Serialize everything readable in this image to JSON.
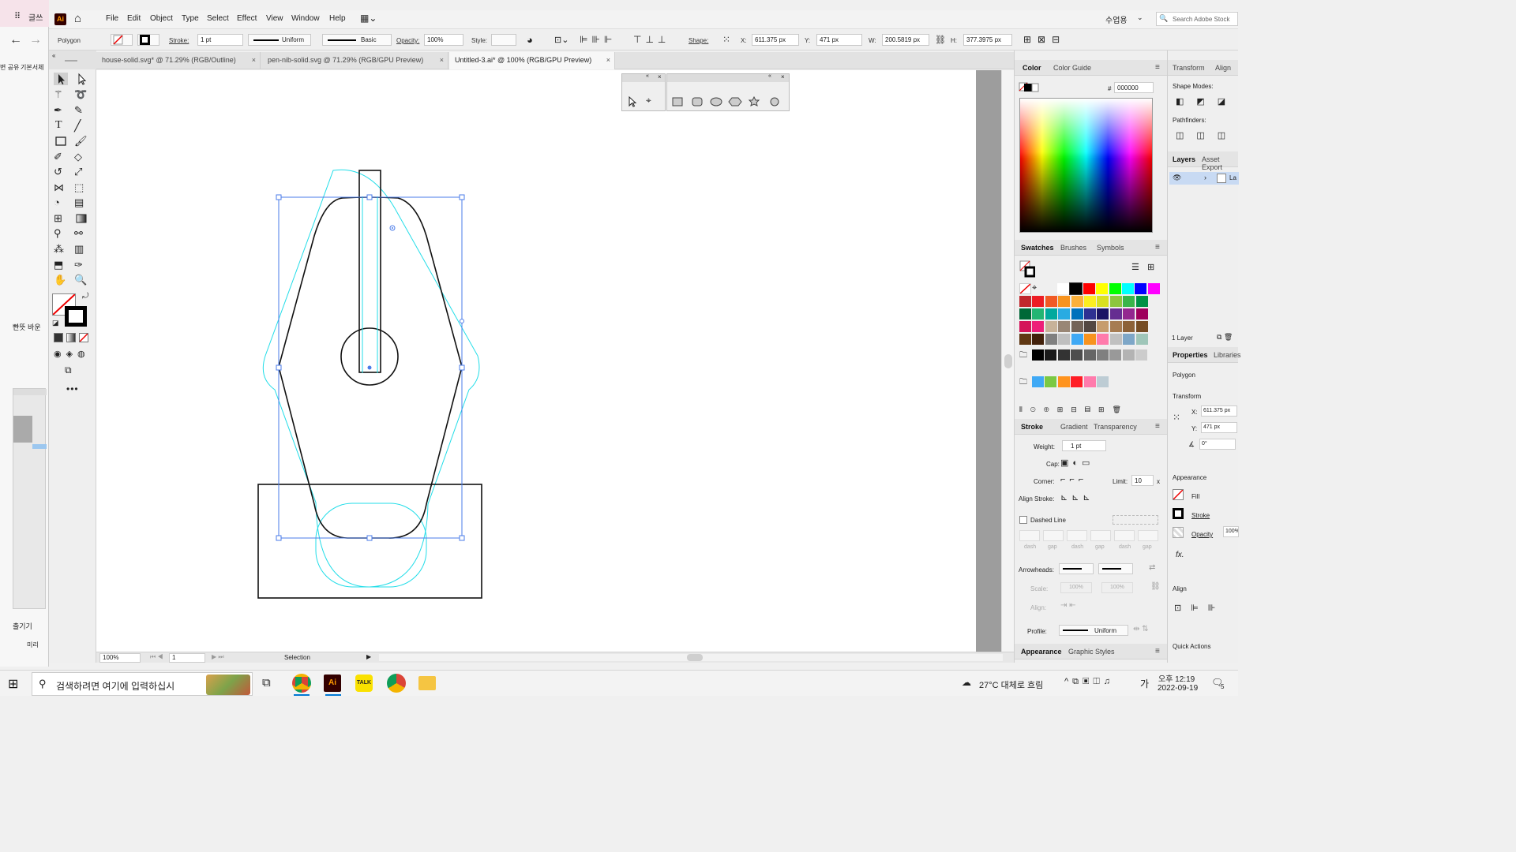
{
  "app": {
    "logo": "Ai",
    "title_left": "글쓰"
  },
  "menu": [
    "File",
    "Edit",
    "Object",
    "Type",
    "Select",
    "Effect",
    "View",
    "Window",
    "Help"
  ],
  "workspace": "수업용",
  "search_stock": "Search Adobe Stock",
  "control": {
    "object_type": "Polygon",
    "stroke_label": "Stroke:",
    "stroke_value": "1 pt",
    "uniform": "Uniform",
    "basic": "Basic",
    "opacity_label": "Opacity:",
    "opacity_value": "100%",
    "style_label": "Style:",
    "shape_label": "Shape:",
    "x_label": "X:",
    "x_value": "611.375 px",
    "y_label": "Y:",
    "y_value": "471 px",
    "w_label": "W:",
    "w_value": "200.5819 px",
    "h_label": "H:",
    "h_value": "377.3975 px"
  },
  "tabs": [
    {
      "label": "house-solid.svg* @ 71.29% (RGB/Outline)",
      "close": "×"
    },
    {
      "label": "pen-nib-solid.svg @ 71.29% (RGB/GPU Preview)",
      "close": "×"
    },
    {
      "label": "Untitled-3.ai* @ 100% (RGB/GPU Preview)",
      "close": "×"
    }
  ],
  "status": {
    "zoom": "100%",
    "artboard": "1",
    "tool": "Selection"
  },
  "color_panel": {
    "tab_color": "Color",
    "tab_guide": "Color Guide",
    "hex_sign": "#",
    "hex": "000000"
  },
  "swatches_panel": {
    "tab_swatches": "Swatches",
    "tab_brushes": "Brushes",
    "tab_symbols": "Symbols",
    "rows": [
      [
        "#ffffff",
        "#000000",
        "#ff0000",
        "#ffff00",
        "#00ff00",
        "#00ffff",
        "#0000ff",
        "#ff00ff"
      ],
      [
        "#c1272d",
        "#ed1c24",
        "#f15a24",
        "#f7931e",
        "#fbb03b",
        "#fcee21",
        "#d9e021",
        "#8cc63f",
        "#39b54a",
        "#009245"
      ],
      [
        "#006837",
        "#22b573",
        "#00a99d",
        "#29abe2",
        "#0071bc",
        "#2e3192",
        "#1b1464",
        "#662d91",
        "#93278f",
        "#9e005d"
      ],
      [
        "#d4145a",
        "#ed1e79",
        "#c7b299",
        "#998675",
        "#736357",
        "#534741",
        "#c69c6d",
        "#a67c52",
        "#8c6239",
        "#754c24"
      ],
      [
        "#603813",
        "#42210b",
        "#808080",
        "#bfbfbf",
        "#3fa9f5",
        "#f7931e",
        "#ff7bac",
        "#c0c0c0",
        "#7ea7c8",
        "#9fc6b9"
      ],
      [
        "#000000",
        "#1a1a1a",
        "#333333",
        "#4d4d4d",
        "#666666",
        "#808080",
        "#999999",
        "#b3b3b3",
        "#cccccc"
      ],
      [
        "#3fa9f5",
        "#7ac943",
        "#ff931e",
        "#ff1d25",
        "#ff7bac",
        "#bdccd4"
      ]
    ]
  },
  "stroke_panel": {
    "tab_stroke": "Stroke",
    "tab_gradient": "Gradient",
    "tab_transparency": "Transparency",
    "weight_label": "Weight:",
    "weight_value": "1 pt",
    "cap_label": "Cap:",
    "corner_label": "Corner:",
    "limit_label": "Limit:",
    "limit_value": "10",
    "limit_unit": "x",
    "align_label": "Align Stroke:",
    "dashed_label": "Dashed Line",
    "dash_labels": [
      "dash",
      "gap",
      "dash",
      "gap",
      "dash",
      "gap"
    ],
    "arrowheads_label": "Arrowheads:",
    "scale_label": "Scale:",
    "scale1": "100%",
    "scale2": "100%",
    "align2_label": "Align:",
    "profile_label": "Profile:",
    "profile_value": "Uniform"
  },
  "bottom_tabs": {
    "appearance": "Appearance",
    "graphic_styles": "Graphic Styles"
  },
  "right": {
    "tab_transform": "Transform",
    "tab_align": "Align",
    "shape_modes": "Shape Modes:",
    "pathfinders": "Pathfinders:",
    "tab_layers": "Layers",
    "tab_asset": "Asset Export",
    "layer_name": "La",
    "layer_count": "1 Layer",
    "tab_properties": "Properties",
    "tab_libraries": "Libraries",
    "obj_type": "Polygon",
    "transform_title": "Transform",
    "x_label": "X:",
    "x_value": "611.375 px",
    "y_label": "Y:",
    "y_value": "471 px",
    "angle_value": "0°",
    "appearance_title": "Appearance",
    "fill": "Fill",
    "stroke": "Stroke",
    "opacity": "Opacity",
    "opacity_value": "100%",
    "fx": "fx.",
    "align_title": "Align",
    "quick_actions": "Quick Actions"
  },
  "bg_window": {
    "snippet1": "변 공유 ",
    "snippet2": "기본서체",
    "snippet3": "빤뜻 바운",
    "snippet4": "출기기",
    "snippet5": "미리"
  },
  "taskbar": {
    "search": "검색하려면 여기에 입력하십시",
    "weather": "27°C 대체로 흐림",
    "ime": "가",
    "time": "오후 12:19",
    "date": "2022-09-19",
    "notif": "5"
  }
}
